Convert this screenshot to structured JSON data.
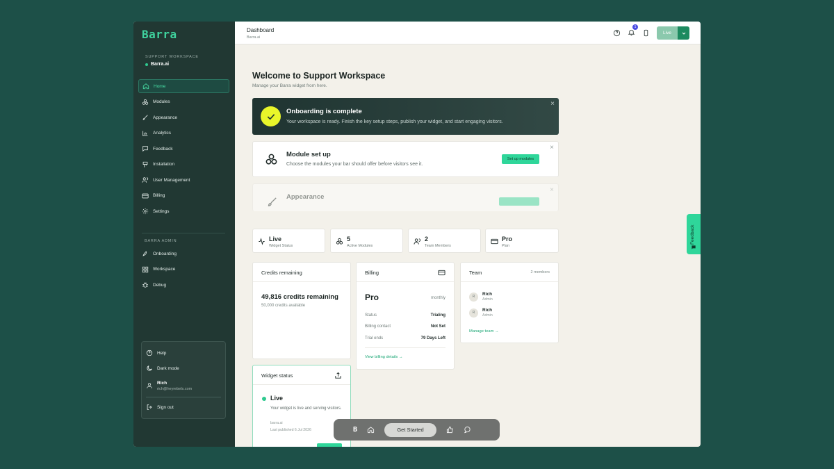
{
  "sidebar": {
    "logo": "Barra",
    "workspace_label": "SUPPORT WORKSPACE",
    "workspace_name": "Barra.ai",
    "items": [
      {
        "label": "Home",
        "icon": "home-icon"
      },
      {
        "label": "Modules",
        "icon": "modules-icon"
      },
      {
        "label": "Appearance",
        "icon": "brush-icon"
      },
      {
        "label": "Analytics",
        "icon": "analytics-icon"
      },
      {
        "label": "Feedback",
        "icon": "feedback-icon"
      },
      {
        "label": "Installation",
        "icon": "installation-icon"
      },
      {
        "label": "User Management",
        "icon": "users-icon"
      },
      {
        "label": "Billing",
        "icon": "card-icon"
      },
      {
        "label": "Settings",
        "icon": "gear-icon"
      }
    ],
    "admin_label": "BARRA ADMIN",
    "admin_items": [
      {
        "label": "Onboarding",
        "icon": "rocket-icon"
      },
      {
        "label": "Workspace",
        "icon": "grid-icon"
      },
      {
        "label": "Debug",
        "icon": "bug-icon"
      }
    ],
    "menu": {
      "help": "Help",
      "dark_mode": "Dark mode",
      "user_name": "Rich",
      "user_email": "rich@heyrebels.com",
      "sign_out": "Sign out"
    }
  },
  "topbar": {
    "title": "Dashboard",
    "subtitle": "Barra.ai",
    "notifications": "1",
    "live_label": "Live"
  },
  "main": {
    "title": "Welcome to Support Workspace",
    "subtitle": "Manage your Barra widget from here.",
    "onboarding": {
      "title": "Onboarding is complete",
      "text": "Your workspace is ready. Finish the key setup steps, publish your widget, and start engaging visitors."
    },
    "module_setup": {
      "title": "Module set up",
      "text": "Choose the modules your bar should offer before visitors see it.",
      "button": "Set up modules"
    },
    "appearance": {
      "title": "Appearance"
    },
    "stats": [
      {
        "value": "Live",
        "label": "Widget Status",
        "icon": "activity-icon"
      },
      {
        "value": "5",
        "label": "Active Modules",
        "icon": "modules-icon"
      },
      {
        "value": "2",
        "label": "Team Members",
        "icon": "users-icon"
      },
      {
        "value": "Pro",
        "label": "Plan",
        "icon": "card-icon"
      }
    ],
    "credits": {
      "title": "Credits remaining",
      "value": "49,816 credits remaining",
      "sub": "50,000 credits available"
    },
    "billing": {
      "title": "Billing",
      "plan": "Pro",
      "period": "monthly",
      "rows": [
        {
          "k": "Status",
          "v": "Trialing"
        },
        {
          "k": "Billing contact",
          "v": "Not Set"
        },
        {
          "k": "Trial ends",
          "v": "79 Days Left"
        }
      ],
      "link": "View billing details →"
    },
    "team": {
      "title": "Team",
      "count": "2 members",
      "members": [
        {
          "initial": "R",
          "name": "Rich",
          "role": "Admin"
        },
        {
          "initial": "R",
          "name": "Rich",
          "role": "Admin"
        }
      ],
      "link": "Manage team →"
    },
    "widget": {
      "title": "Widget status",
      "state": "Live",
      "text": "Your widget is live and serving visitors.",
      "domain": "barra.ai",
      "published": "Last published 6 Jul 2026"
    }
  },
  "feedback_tab": "Feedback",
  "bottom_bar": {
    "cta": "Get Started",
    "logo": "B"
  }
}
